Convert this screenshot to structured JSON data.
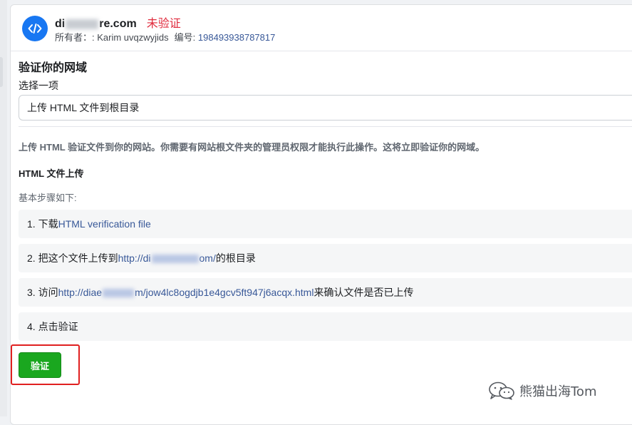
{
  "header": {
    "domain_prefix": "di",
    "domain_suffix": "re.com",
    "status": "未验证",
    "owner_label": "所有者：",
    "owner_name": ": Karim uvqzwyjids",
    "id_label": "编号:",
    "id_value": "198493938787817"
  },
  "section": {
    "title": "验证你的网域",
    "select_label": "选择一项",
    "select_value": "上传 HTML 文件到根目录",
    "description": "上传 HTML 验证文件到你的网站。你需要有网站根文件夹的管理员权限才能执行此操作。这将立即验证你的网域。",
    "subheading": "HTML 文件上传",
    "steps_intro": "基本步骤如下:"
  },
  "steps": [
    {
      "prefix": "1. 下载",
      "link": "HTML verification file",
      "suffix": ""
    },
    {
      "prefix": "2. 把这个文件上传到",
      "link_start": "http://di",
      "link_end": "om/",
      "suffix": "的根目录"
    },
    {
      "prefix": "3. 访问",
      "link_start": "http://diae",
      "link_end": "m/jow4lc8ogdjb1e4gcv5ft947j6acqx.html",
      "suffix": "来确认文件是否已上传"
    },
    {
      "prefix": "4. 点击验证"
    }
  ],
  "verify_button": "验证",
  "watermark": "熊猫出海Tom",
  "colors": {
    "accent_blue": "#1877f2",
    "link_blue": "#385898",
    "status_red": "#e02b3d",
    "button_green": "#1aa71f",
    "highlight_red": "#e02020"
  },
  "icons": {
    "domain": "code-icon",
    "watermark": "wechat-icon"
  }
}
